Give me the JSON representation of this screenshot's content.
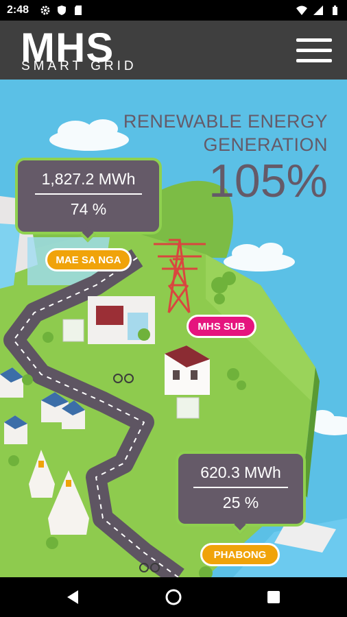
{
  "status_bar": {
    "time": "2:48",
    "left_icons": [
      "gear-icon",
      "shield-icon",
      "sd-card-icon"
    ],
    "right_icons": [
      "wifi-icon",
      "signal-icon",
      "battery-icon"
    ]
  },
  "header": {
    "logo_main": "MHS",
    "logo_sub": "SMART GRID",
    "menu_icon": "hamburger-menu-icon"
  },
  "headline": {
    "line1": "RENEWABLE ENERGY",
    "line2": "GENERATION",
    "percent": "105%"
  },
  "stations": {
    "mae_sa_nga": {
      "energy": "1,827.2 MWh",
      "percent": "74 %",
      "label": "MAE SA NGA"
    },
    "mhs_sub": {
      "label": "MHS SUB"
    },
    "phabong": {
      "energy": "620.3 MWh",
      "percent": "25 %",
      "label": "PHABONG"
    }
  },
  "colors": {
    "sky": "#5bc0e6",
    "bubble_fill": "#655a68",
    "bubble_border": "#8fd14f",
    "tag_orange": "#f0a30a",
    "tag_pink": "#e5157e",
    "grass": "#8ecb4e",
    "road": "#5e5562"
  },
  "nav": {
    "back_icon": "back-triangle-icon",
    "home_icon": "home-circle-icon",
    "recents_icon": "recents-square-icon"
  }
}
